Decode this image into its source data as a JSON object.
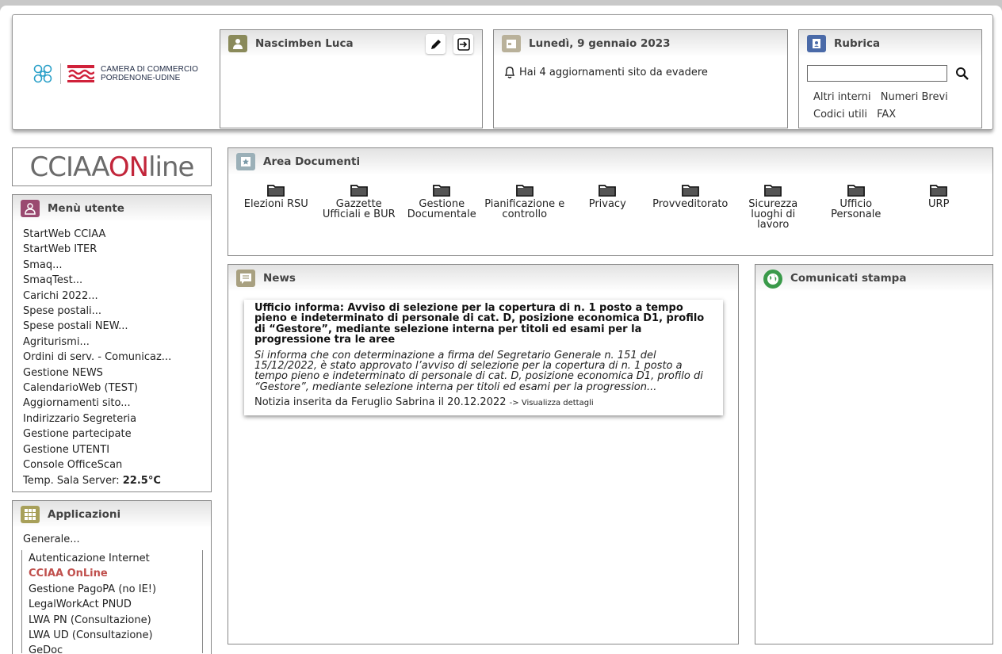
{
  "header": {
    "logo_text_1": "CAMERA DI COMMERCIO",
    "logo_text_2": "PORDENONE-UDINE",
    "user_panel": {
      "name": "Nascimben Luca",
      "edit_icon": "pencil-icon",
      "logout_icon": "logout-icon"
    },
    "date_panel": {
      "date": "Lunedì, 9 gennaio 2023",
      "notice": "Hai 4 aggiornamenti sito da evadere"
    },
    "rubrica": {
      "title": "Rubrica",
      "search_value": "",
      "links": [
        "Altri interni",
        "Numeri Brevi",
        "Codici utili",
        "FAX"
      ]
    }
  },
  "online_logo": {
    "part1": "CCIAA",
    "part2": "ON",
    "part3": "line"
  },
  "user_menu": {
    "title": "Menù utente",
    "items": [
      "StartWeb CCIAA",
      "StartWeb ITER",
      "Smaq...",
      "SmaqTest...",
      "Carichi 2022...",
      "Spese postali...",
      "Spese postali NEW...",
      "Agriturismi...",
      "Ordini di serv. - Comunicaz...",
      "Gestione NEWS",
      "CalendarioWeb (TEST)",
      "Aggiornamenti sito...",
      "Indirizzario Segreteria",
      "Gestione partecipate",
      "Gestione UTENTI",
      "Console OfficeScan"
    ],
    "temp_label": "Temp. Sala Server:",
    "temp_value": "22.5°C"
  },
  "applications": {
    "title": "Applicazioni",
    "group": "Generale...",
    "items": [
      "Autenticazione Internet",
      "CCIAA OnLine",
      "Gestione PagoPA (no IE!)",
      "LegalWorkAct PNUD",
      "LWA PN (Consultazione)",
      "LWA UD (Consultazione)",
      "GeDoc"
    ]
  },
  "documents": {
    "title": "Area Documenti",
    "folders": [
      "Elezioni RSU",
      "Gazzette Ufficiali e BUR",
      "Gestione Documentale",
      "Pianificazione e controllo",
      "Privacy",
      "Provveditorato",
      "Sicurezza luoghi di lavoro",
      "Ufficio Personale",
      "URP"
    ]
  },
  "news": {
    "title": "News",
    "item": {
      "headline": "Ufficio informa: Avviso di selezione per la copertura di n. 1 posto a tempo pieno e indeterminato di personale di cat. D, posizione economica D1, profilo di “Gestore”, mediante selezione interna per titoli ed esami per la progressione tra le aree",
      "summary": "Si informa che con determinazione a firma del Segretario Generale n. 151 del 15/12/2022, è stato approvato l’avviso di selezione per la copertura di n. 1 posto a tempo pieno e indeterminato di personale di cat. D, posizione economica D1, profilo di “Gestore”, mediante selezione interna per titoli ed esami per la progression...",
      "meta": "Notizia inserita da Feruglio Sabrina il 20.12.2022",
      "details_link": "-> Visualizza dettagli"
    }
  },
  "press": {
    "title": "Comunicati stampa"
  }
}
